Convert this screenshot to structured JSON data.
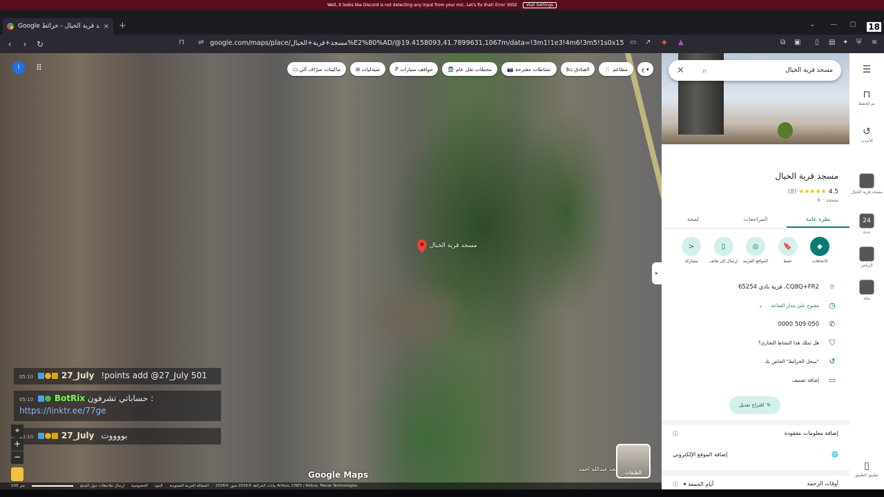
{
  "notification": {
    "text": "Well, it looks like Discord is not detecting any input from your mic. Let's fix that!   Error 3002",
    "button": "Visit Settings"
  },
  "browser": {
    "tab_title": "Google مسجد قرية الخيال - خرائط",
    "tab_close": "×",
    "new_tab": "+",
    "url": "google.com/maps/place/مسجد+قرية+الخيال%E2%80%AD/@19.4158093,41.7899631,1067m/data=!3m1!1e3!4m6!3m5!1s0x15e5996c3559e6b9:0...",
    "rating_badge": "18"
  },
  "map": {
    "user_initial": "I",
    "chips": [
      "مطاعم",
      "الفنادق",
      "نشاطات مقترحة",
      "محطات نقل عام",
      "مواقف سيارات",
      "صيدليات",
      "ماكينات صرّاف آلي"
    ],
    "chip_icons": [
      "🍴",
      "🛏",
      "📷",
      "🚍",
      "P",
      "⊞",
      "▭"
    ],
    "more_chip": "ع",
    "pin_label": "مسجد قرية الخيال",
    "secondary_label": "مسجد عبدالله احمد",
    "layers_label": "الطبقات",
    "logo": "Google Maps",
    "attribution": [
      "بيانات الخرائط ©2026 صور ©2026 Airbus, CNES / Airbus, Maxar Technologies",
      "المملكة العربية السعودية",
      "البنود",
      "الخصوصية",
      "إرسال ملاحظات حول المنتج",
      "100 متر"
    ],
    "zoom_in": "+",
    "zoom_out": "−"
  },
  "chat": [
    {
      "time": "05:10",
      "name": "27_July",
      "name_color": "#e9e4c6",
      "message": "!points add @27_July 501"
    },
    {
      "time": "05:10",
      "name": "BotRix",
      "name_color": "#7ff04a",
      "message": "حساباتي تشرفون :",
      "link": "https://linktr.ee/77ge"
    },
    {
      "time": "05:10",
      "name": "27_July",
      "name_color": "#e9e4c6",
      "message": "بووووت"
    }
  ],
  "panel": {
    "search_query": "مسجد قرية الخيال",
    "title": "مسجد قرية الخيال",
    "rating": "4.5",
    "stars": "★★★★★",
    "reviews": "(8)",
    "category": "مسجد ·",
    "tabs": [
      "نظرة عامة",
      "المراجعات",
      "لمحة"
    ],
    "actions": [
      {
        "label": "الاتجاهات",
        "icon": "◆"
      },
      {
        "label": "حفظ",
        "icon": "🔖"
      },
      {
        "label": "المواقع القريبة",
        "icon": "◎"
      },
      {
        "label": "إرسال إلى هاتف",
        "icon": "▯"
      },
      {
        "label": "مشاركة",
        "icon": "<"
      }
    ],
    "address": "CQ8Q+FR2، قرية بادي 65254",
    "hours": "مفتوح على مدار الساعة",
    "phone": "050 509 0000",
    "claim": "هل تملك هذا النشاط التجاري؟",
    "history": "\"سجل الخرائط\" الخاص بك",
    "add_label": "إضافة تصنيف",
    "suggest_edit": "اقتراح تعديل",
    "add_missing": "إضافة معلومات مفقودة",
    "add_website": "إضافة الموقع الإلكتروني",
    "busy_title": "أوقات الزحمة",
    "busy_day": "أيام الجمعة"
  },
  "rail": {
    "saved": "تم الحفظ",
    "recent": "الأحدث",
    "place1": "مسجد قرية الخيال",
    "place2": "جدة",
    "place3": "الرياض",
    "place4": "مكة",
    "app": "تطبيق الطبيق",
    "n24": "24"
  }
}
